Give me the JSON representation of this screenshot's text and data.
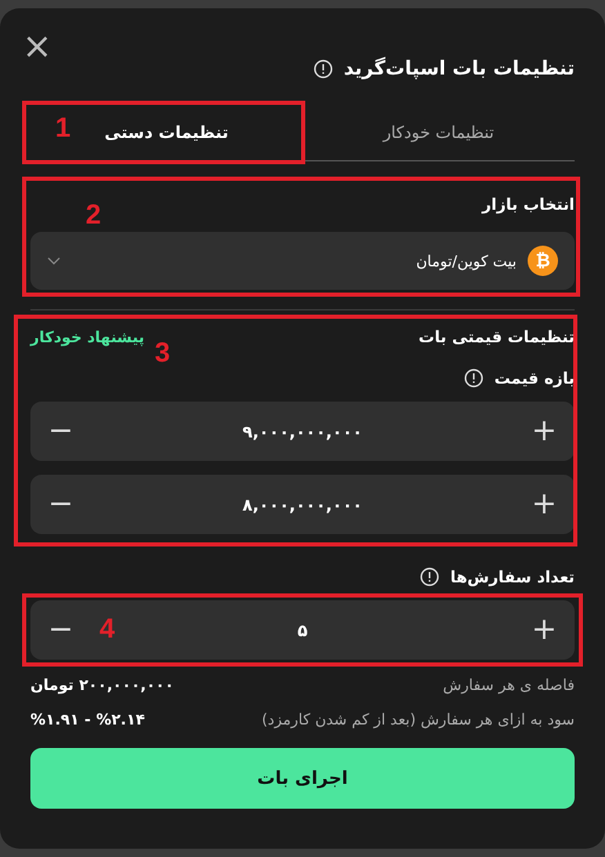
{
  "dialog": {
    "title": "تنظیمات بات اسپات‌گرید",
    "close": "×"
  },
  "tabs": [
    {
      "label": "تنظیمات خودکار",
      "selected": false
    },
    {
      "label": "تنظیمات دستی",
      "selected": true,
      "annotation": "1"
    }
  ],
  "market": {
    "label": "انتخاب بازار",
    "value": "بیت کوین/تومان",
    "coin": "₿",
    "annotation": "2"
  },
  "price_settings": {
    "title": "تنظیمات قیمتی بات",
    "auto_suggest": "پیشنهاد خودکار",
    "range_label": "بازه قیمت",
    "annotation": "3",
    "steppers": [
      {
        "value": "۹,۰۰۰,۰۰۰,۰۰۰",
        "minus": "−",
        "plus": "+"
      },
      {
        "value": "۸,۰۰۰,۰۰۰,۰۰۰",
        "minus": "−",
        "plus": "+"
      }
    ]
  },
  "orders": {
    "label": "تعداد سفارش‌ها",
    "annotation": "4",
    "stepper": {
      "value": "۵",
      "minus": "−",
      "plus": "+"
    }
  },
  "info_rows": [
    {
      "kind": "amount",
      "label": "فاصله ی هر سفارش",
      "value": "۲۰۰,۰۰۰,۰۰۰ تومان"
    },
    {
      "kind": "percent",
      "label": "سود به ازای هر سفارش (بعد از کم شدن کارمزد)",
      "value": "%۱.۹۱ - %۲.۱۴"
    }
  ],
  "run_button": "اجرای بات"
}
